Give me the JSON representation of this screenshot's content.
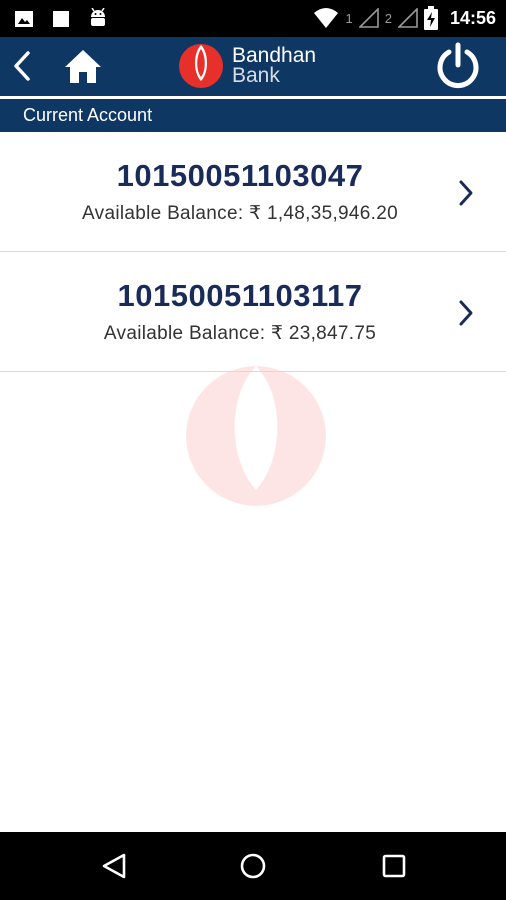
{
  "status_bar": {
    "time": "14:56",
    "sim1_label": "1",
    "sim2_label": "2",
    "icons": [
      "image-icon",
      "stop-icon",
      "android-icon",
      "wifi-icon",
      "signal-icon",
      "battery-charging-icon"
    ]
  },
  "header": {
    "brand_line1": "Bandhan",
    "brand_line2": "Bank",
    "back_icon": "chevron-left-icon",
    "home_icon": "home-icon",
    "power_icon": "power-icon"
  },
  "section": {
    "title": "Current Account"
  },
  "accounts": [
    {
      "number": "10150051103047",
      "balance": "Available Balance: ₹ 1,48,35,946.20"
    },
    {
      "number": "10150051103117",
      "balance": "Available Balance: ₹ 23,847.75"
    }
  ],
  "nav": {
    "icons": [
      "back-triangle-icon",
      "home-circle-icon",
      "recents-square-icon"
    ]
  },
  "colors": {
    "header_bg": "#0f3763",
    "account_number": "#1a2b5a",
    "brand_red": "#e8302a"
  }
}
